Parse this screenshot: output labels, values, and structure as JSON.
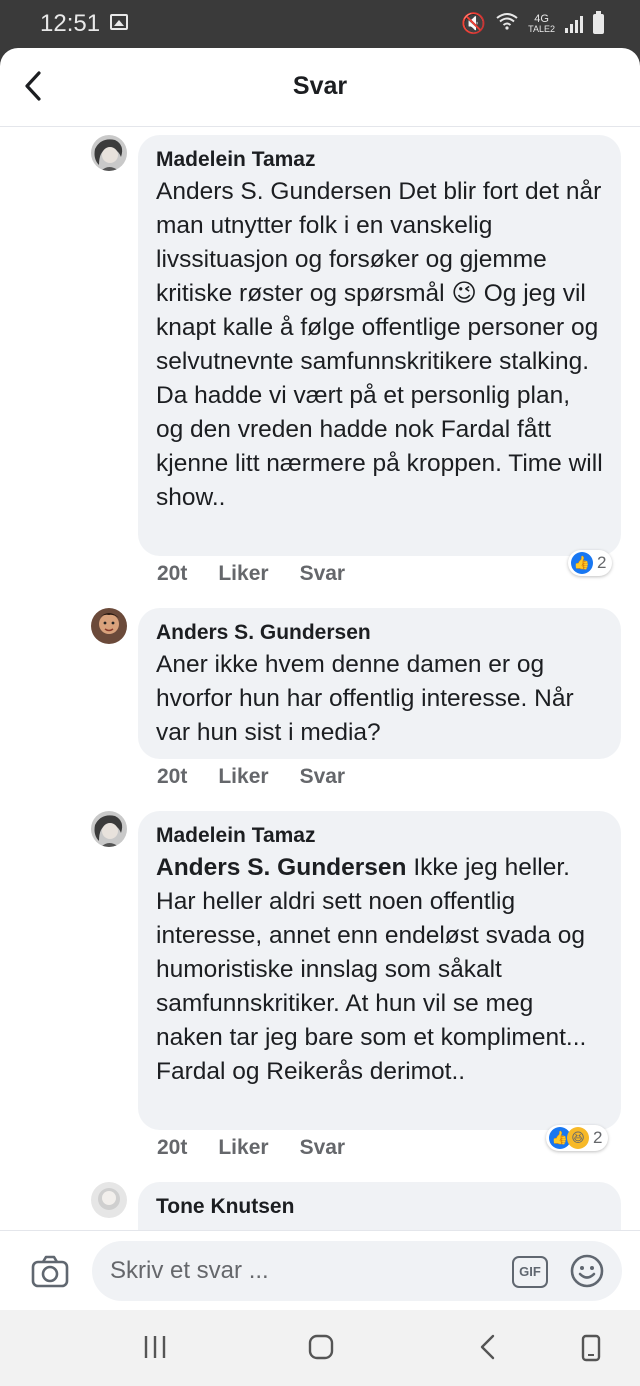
{
  "status_bar": {
    "time": "12:51",
    "network_top": "4G",
    "network_bottom": "TALE2"
  },
  "header": {
    "title": "Svar"
  },
  "comments": [
    {
      "author": "Madelein Tamaz",
      "text": "Anders S. Gundersen Det blir fort det når man utnytter folk i en vanskelig livssituasjon og forsøker og gjemme kritiske røster og spørsmål 😉 Og jeg vil knapt kalle å følge offentlige personer og selvutnevnte samfunnskritikere stalking. Da hadde vi vært på et personlig plan, og den vreden hadde nok Fardal fått kjenne litt nærmere på kroppen. Time will show..",
      "time": "20t",
      "like": "Liker",
      "reply": "Svar",
      "reaction_count": "2"
    },
    {
      "author": "Anders S. Gundersen",
      "text": "Aner ikke hvem denne damen er og hvorfor hun har offentlig interesse. Når var hun sist i media?",
      "time": "20t",
      "like": "Liker",
      "reply": "Svar"
    },
    {
      "author": "Madelein Tamaz",
      "mention": "Anders S. Gundersen",
      "text": " Ikke jeg heller. Har heller aldri sett noen offentlig interesse, annet enn endeløst svada og humoristiske innslag som såkalt samfunnskritiker. At hun vil se meg naken tar jeg bare som et kompliment...\nFardal og Reikerås derimot..",
      "time": "20t",
      "like": "Liker",
      "reply": "Svar",
      "reaction_count": "2"
    },
    {
      "author": "Tone Knutsen"
    }
  ],
  "compose": {
    "placeholder": "Skriv et svar ...",
    "gif_label": "GIF"
  },
  "colors": {
    "accent": "#1877f2",
    "bubble": "#f0f2f5",
    "meta": "#65676b"
  }
}
